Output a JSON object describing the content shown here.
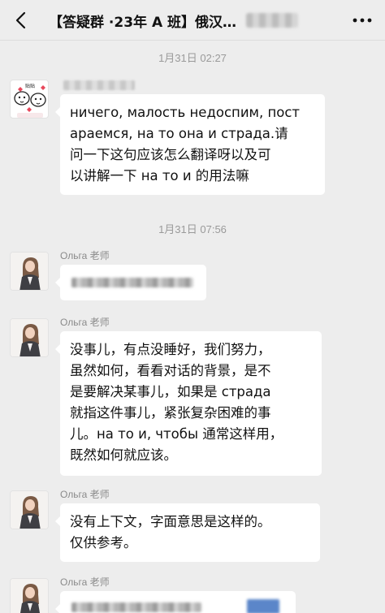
{
  "header": {
    "title": "【答疑群 ·23年 A 班】俄汉…",
    "back_icon": "chevron-left-icon",
    "more_icon": "more-dots-icon"
  },
  "messages": [
    {
      "type": "timestamp",
      "text": "1月31日 02:27"
    },
    {
      "type": "message",
      "sender": "",
      "avatar": "sticker-avatar",
      "sticker_text": "贴贴",
      "lines": [
        "ничего, малость недоспим, пост",
        "араемся, на то она и страда.请",
        "问一下这句应该怎么翻译呀以及可",
        "以讲解一下 на то и 的用法嘛"
      ]
    },
    {
      "type": "timestamp",
      "text": "1月31日 07:56"
    },
    {
      "type": "message",
      "sender": "Ольга 老师",
      "avatar": "teacher-avatar",
      "lines": []
    },
    {
      "type": "message",
      "sender": "Ольга 老师",
      "avatar": "teacher-avatar",
      "lines": [
        "没事儿，有点没睡好，我们努力，",
        "虽然如何，看看对话的背景，是不",
        "是要解决某事儿，如果是 страда",
        "就指这件事儿，紧张复杂困难的事",
        "儿。на то и, чтобы 通常这样用，",
        "既然如何就应该。"
      ]
    },
    {
      "type": "message",
      "sender": "Ольга 老师",
      "avatar": "teacher-avatar",
      "lines": [
        "没有上下文，字面意思是这样的。",
        "仅供参考。"
      ]
    },
    {
      "type": "message",
      "sender": "Ольга 老师",
      "avatar": "teacher-avatar",
      "lines": []
    }
  ]
}
